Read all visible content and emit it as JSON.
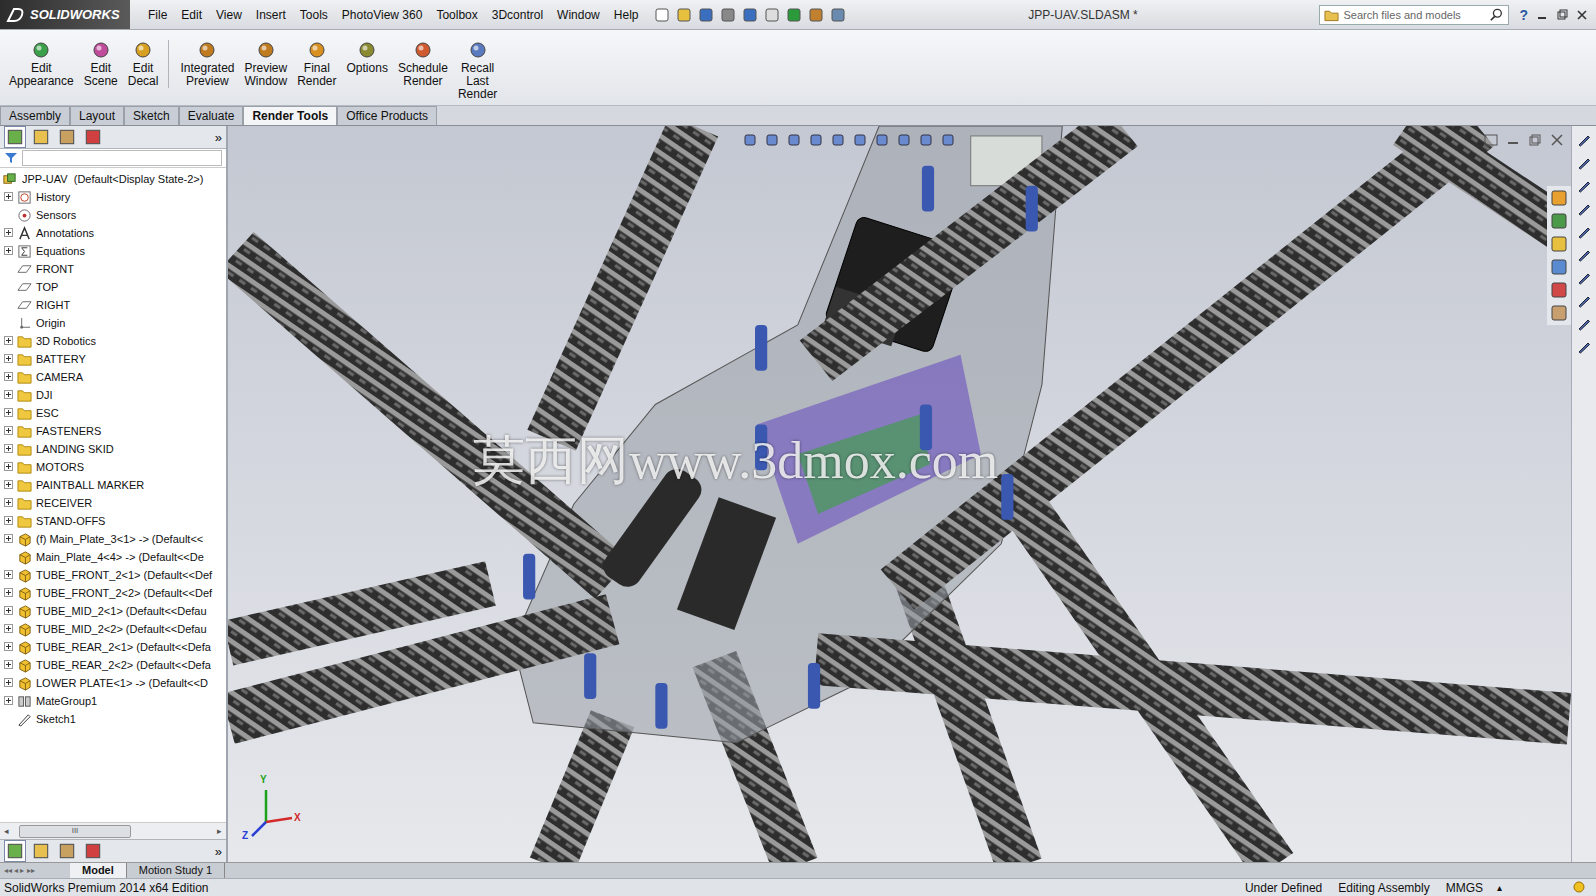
{
  "app": {
    "logo": "SOLIDWORKS"
  },
  "menu": [
    "File",
    "Edit",
    "View",
    "Insert",
    "Tools",
    "PhotoView 360",
    "Toolbox",
    "3Dcontrol",
    "Window",
    "Help"
  ],
  "window": {
    "title": "JPP-UAV.SLDASM *"
  },
  "search": {
    "placeholder": "Search files and models"
  },
  "help": "?",
  "ribbon": [
    {
      "lines": [
        "Edit",
        "Appearance"
      ]
    },
    {
      "lines": [
        "Edit",
        "Scene"
      ]
    },
    {
      "lines": [
        "Edit",
        "Decal"
      ]
    },
    {
      "lines": [
        "Integrated",
        "Preview"
      ]
    },
    {
      "lines": [
        "Preview",
        "Window"
      ]
    },
    {
      "lines": [
        "Final",
        "Render"
      ]
    },
    {
      "lines": [
        "Options"
      ]
    },
    {
      "lines": [
        "Schedule",
        "Render"
      ]
    },
    {
      "lines": [
        "Recall",
        "Last",
        "Render"
      ]
    }
  ],
  "tabs": [
    {
      "label": "Assembly",
      "selected": false
    },
    {
      "label": "Layout",
      "selected": false
    },
    {
      "label": "Sketch",
      "selected": false
    },
    {
      "label": "Evaluate",
      "selected": false
    },
    {
      "label": "Render Tools",
      "selected": true
    },
    {
      "label": "Office Products",
      "selected": false
    }
  ],
  "panel_chevron": "»",
  "tree": {
    "root": "JPP-UAV  (Default<Display State-2>)",
    "items": [
      {
        "label": "History",
        "kind": "history",
        "expandable": true
      },
      {
        "label": "Sensors",
        "kind": "sensor",
        "expandable": false
      },
      {
        "label": "Annotations",
        "kind": "annotation",
        "expandable": true
      },
      {
        "label": "Equations",
        "kind": "equation",
        "expandable": true
      },
      {
        "label": "FRONT",
        "kind": "plane",
        "expandable": false
      },
      {
        "label": "TOP",
        "kind": "plane",
        "expandable": false
      },
      {
        "label": "RIGHT",
        "kind": "plane",
        "expandable": false
      },
      {
        "label": "Origin",
        "kind": "origin",
        "expandable": false
      },
      {
        "label": "3D Robotics",
        "kind": "folder",
        "expandable": true
      },
      {
        "label": "BATTERY",
        "kind": "folder",
        "expandable": true
      },
      {
        "label": "CAMERA",
        "kind": "folder",
        "expandable": true
      },
      {
        "label": "DJI",
        "kind": "folder",
        "expandable": true
      },
      {
        "label": "ESC",
        "kind": "folder",
        "expandable": true
      },
      {
        "label": "FASTENERS",
        "kind": "folder",
        "expandable": true
      },
      {
        "label": "LANDING SKID",
        "kind": "folder",
        "expandable": true
      },
      {
        "label": "MOTORS",
        "kind": "folder",
        "expandable": true
      },
      {
        "label": "PAINTBALL MARKER",
        "kind": "folder",
        "expandable": true
      },
      {
        "label": "RECEIVER",
        "kind": "folder",
        "expandable": true
      },
      {
        "label": "STAND-OFFS",
        "kind": "folder",
        "expandable": true
      },
      {
        "label": "(f) Main_Plate_3<1> -> (Default<<",
        "kind": "part",
        "expandable": true
      },
      {
        "label": "Main_Plate_4<4> -> (Default<<De",
        "kind": "part",
        "expandable": false
      },
      {
        "label": "TUBE_FRONT_2<1> (Default<<Def",
        "kind": "part",
        "expandable": true
      },
      {
        "label": "TUBE_FRONT_2<2> (Default<<Def",
        "kind": "part",
        "expandable": true
      },
      {
        "label": "TUBE_MID_2<1> (Default<<Defau",
        "kind": "part",
        "expandable": true
      },
      {
        "label": "TUBE_MID_2<2> (Default<<Defau",
        "kind": "part",
        "expandable": true
      },
      {
        "label": "TUBE_REAR_2<1> (Default<<Defa",
        "kind": "part",
        "expandable": true
      },
      {
        "label": "TUBE_REAR_2<2> (Default<<Defa",
        "kind": "part",
        "expandable": true
      },
      {
        "label": "LOWER PLATE<1> -> (Default<<D",
        "kind": "part",
        "expandable": true
      },
      {
        "label": "MateGroup1",
        "kind": "mategroup",
        "expandable": true
      },
      {
        "label": "Sketch1",
        "kind": "sketch",
        "expandable": false
      }
    ]
  },
  "scroll_grip": "III",
  "bottom_tabs": [
    {
      "label": "Model",
      "selected": true
    },
    {
      "label": "Motion Study 1",
      "selected": false
    }
  ],
  "viewport": {
    "watermark": "莫西网www.3dmox.com"
  },
  "triad": [
    {
      "label": "Y",
      "color": "#1aa31a"
    },
    {
      "label": "X",
      "color": "#d42a2a"
    },
    {
      "label": "Z",
      "color": "#2a3fd4"
    }
  ],
  "status_bar": {
    "edition": "SolidWorks Premium 2014 x64 Edition",
    "fields": [
      "Under Defined",
      "Editing Assembly",
      "MMGS"
    ],
    "arrow": "▴"
  }
}
